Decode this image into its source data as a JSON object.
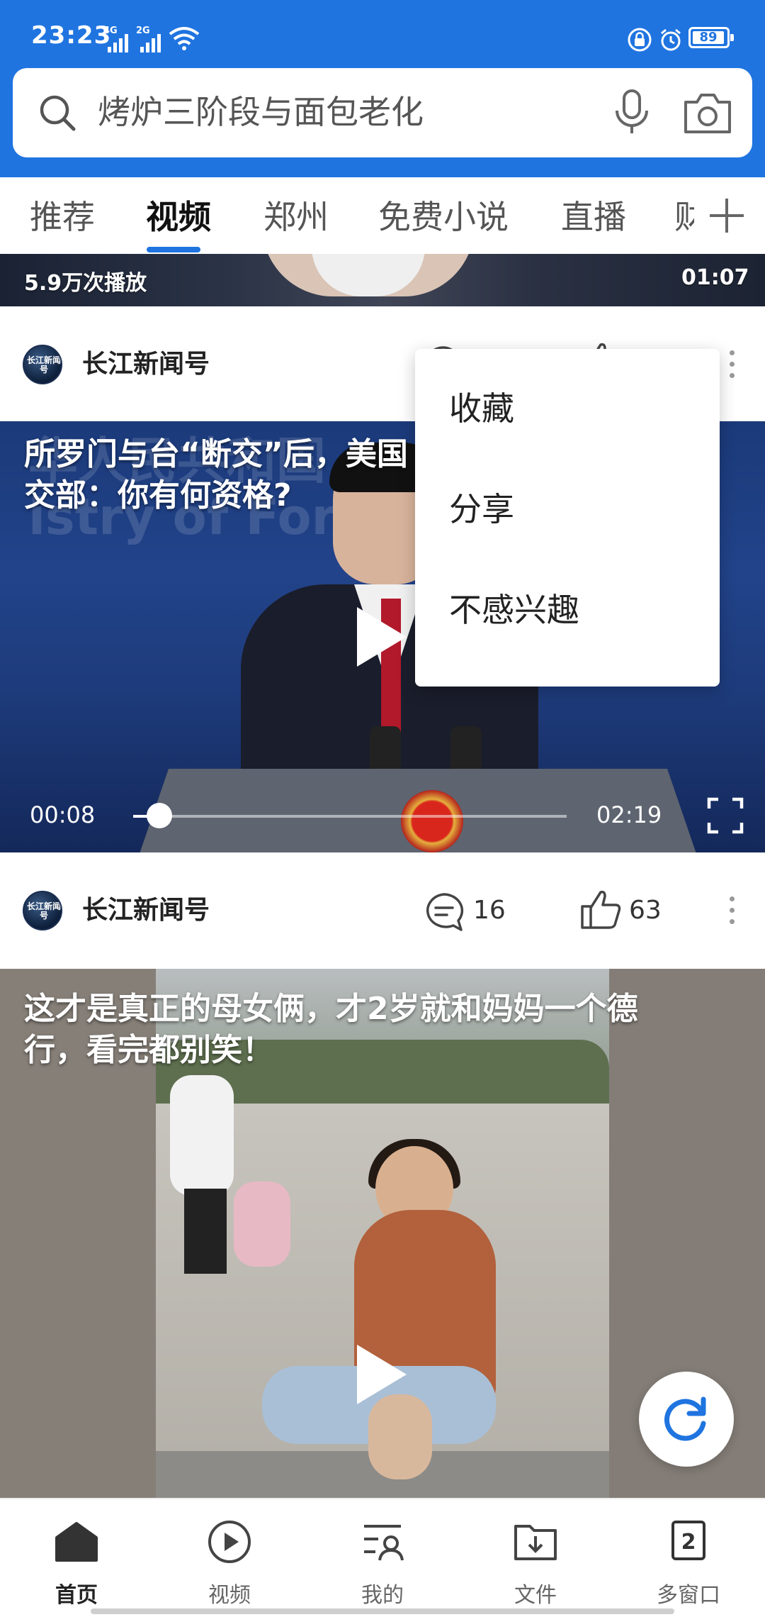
{
  "status_bar": {
    "time": "23:23",
    "signal1_label": "4G",
    "signal2_label": "2G",
    "battery": "89"
  },
  "search": {
    "placeholder": "烤炉三阶段与面包老化"
  },
  "tabs": {
    "items": [
      "推荐",
      "视频",
      "郑州",
      "免费小说",
      "直播",
      "财"
    ],
    "active": "视频"
  },
  "feed": {
    "partial_video": {
      "plays": "5.9万次播放",
      "duration": "01:07"
    },
    "post1": {
      "author": "长江新闻号",
      "avatar_logo": "长江新闻号",
      "title": "所罗门与台“断交”后，美国",
      "title_line2": "交部：你有何资格?",
      "title_end": "",
      "bg_text": "华人民共和国",
      "bg_text2": "istry of Fore",
      "player": {
        "current_time": "00:08",
        "total_time": "02:19",
        "progress_percent": 6
      }
    },
    "post1_meta": {
      "author": "长江新闻号",
      "comments": "16",
      "likes": "63"
    },
    "post2": {
      "title": "这才是真正的母女俩，才2岁就和妈妈一个德",
      "title_line2": "行，看完都别笑！"
    }
  },
  "popup_menu": {
    "items": [
      "收藏",
      "分享",
      "不感兴趣"
    ]
  },
  "bottom_nav": {
    "items": [
      {
        "label": "首页",
        "icon": "home-icon"
      },
      {
        "label": "视频",
        "icon": "play-circle-icon"
      },
      {
        "label": "我的",
        "icon": "profile-list-icon"
      },
      {
        "label": "文件",
        "icon": "folder-download-icon"
      },
      {
        "label": "多窗口",
        "icon": "multi-window-icon",
        "badge": "2"
      }
    ],
    "active": "首页"
  },
  "colors": {
    "brand": "#1f74e0",
    "background": "#ffffff"
  }
}
